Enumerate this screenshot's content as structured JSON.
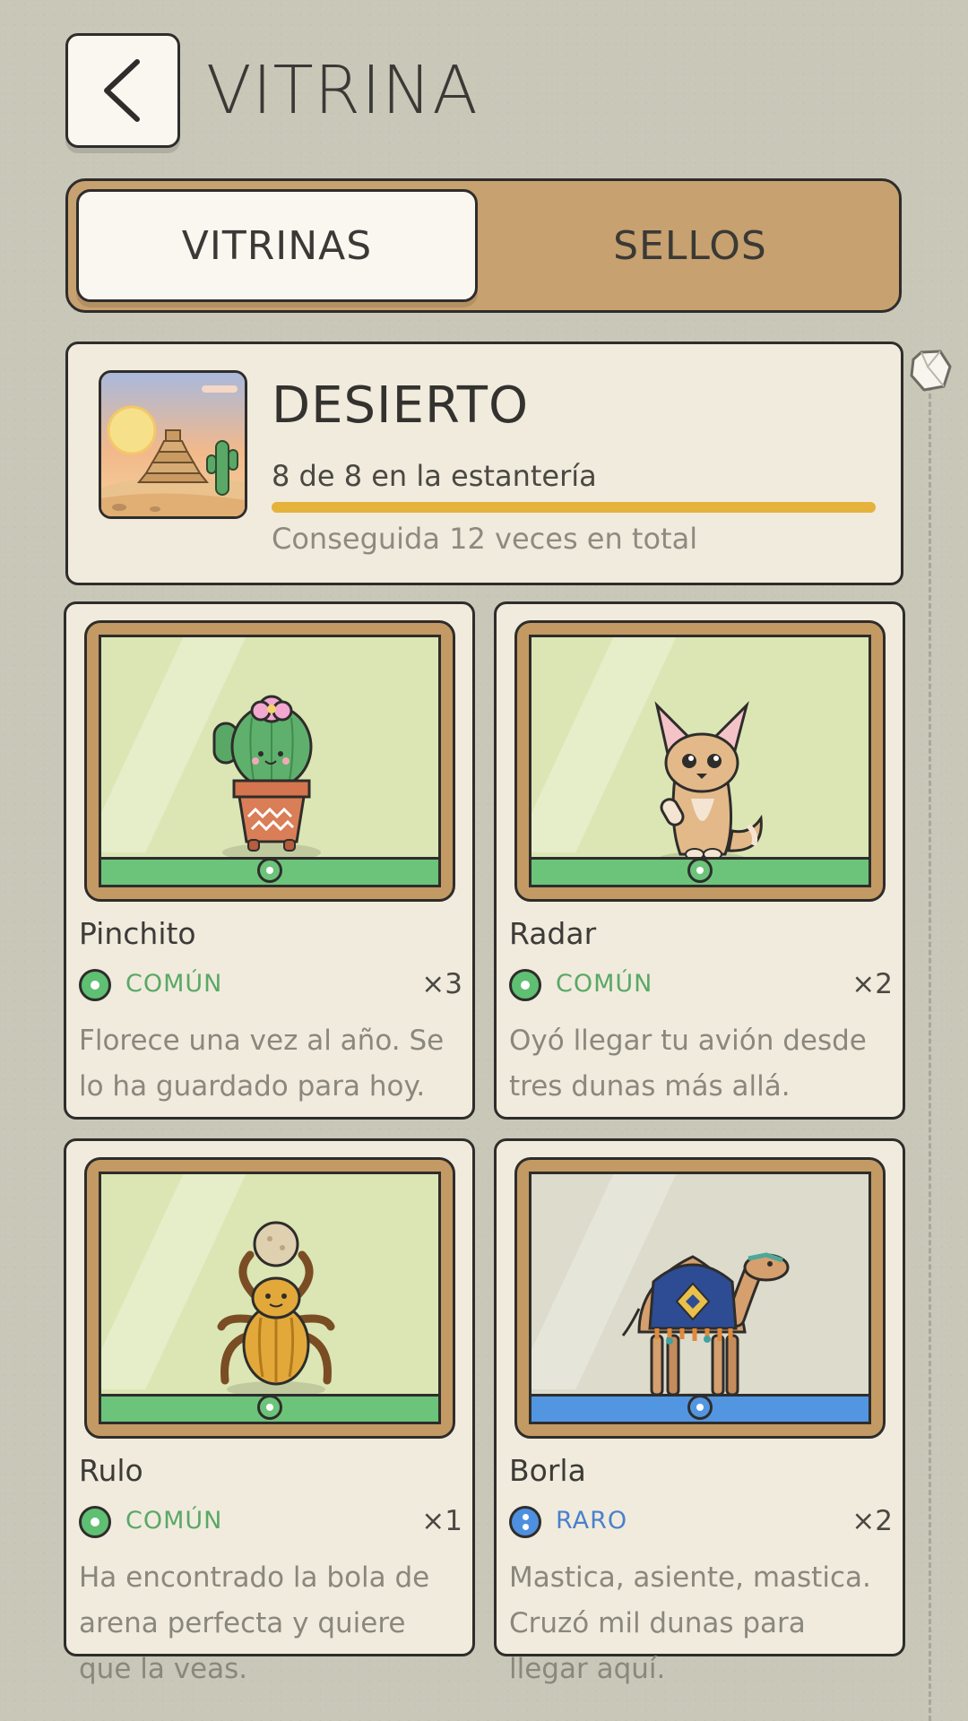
{
  "header": {
    "title": "VITRINA"
  },
  "tabs": [
    {
      "label": "VITRINAS",
      "active": true
    },
    {
      "label": "SELLOS",
      "active": false
    }
  ],
  "collection": {
    "title": "DESIERTO",
    "count_text": "8 de 8 en la estantería",
    "progress": 1.0,
    "total_text": "Conseguida 12 veces en total",
    "icon": "desert-pyramid-icon"
  },
  "cards": [
    {
      "name": "Pinchito",
      "rarity": "COMÚN",
      "count": "×3",
      "desc": "Florece una vez al año. Se lo ha guardado para hoy.",
      "icon": "cactus-icon"
    },
    {
      "name": "Radar",
      "rarity": "COMÚN",
      "count": "×2",
      "desc": "Oyó llegar tu avión desde tres dunas más allá.",
      "icon": "fennec-fox-icon"
    },
    {
      "name": "Rulo",
      "rarity": "COMÚN",
      "count": "×1",
      "desc": "Ha encontrado la bola de arena perfecta y quiere que la veas.",
      "icon": "scarab-beetle-icon"
    },
    {
      "name": "Borla",
      "rarity": "RARO",
      "count": "×2",
      "desc": "Mastica, asiente, mastica. Cruzó mil dunas para llegar aquí.",
      "icon": "camel-icon"
    }
  ],
  "colors": {
    "common": "#5fbf73",
    "rare": "#4f8fe0",
    "progress": "#e5b23c",
    "tab_bg": "#c7a16f"
  }
}
